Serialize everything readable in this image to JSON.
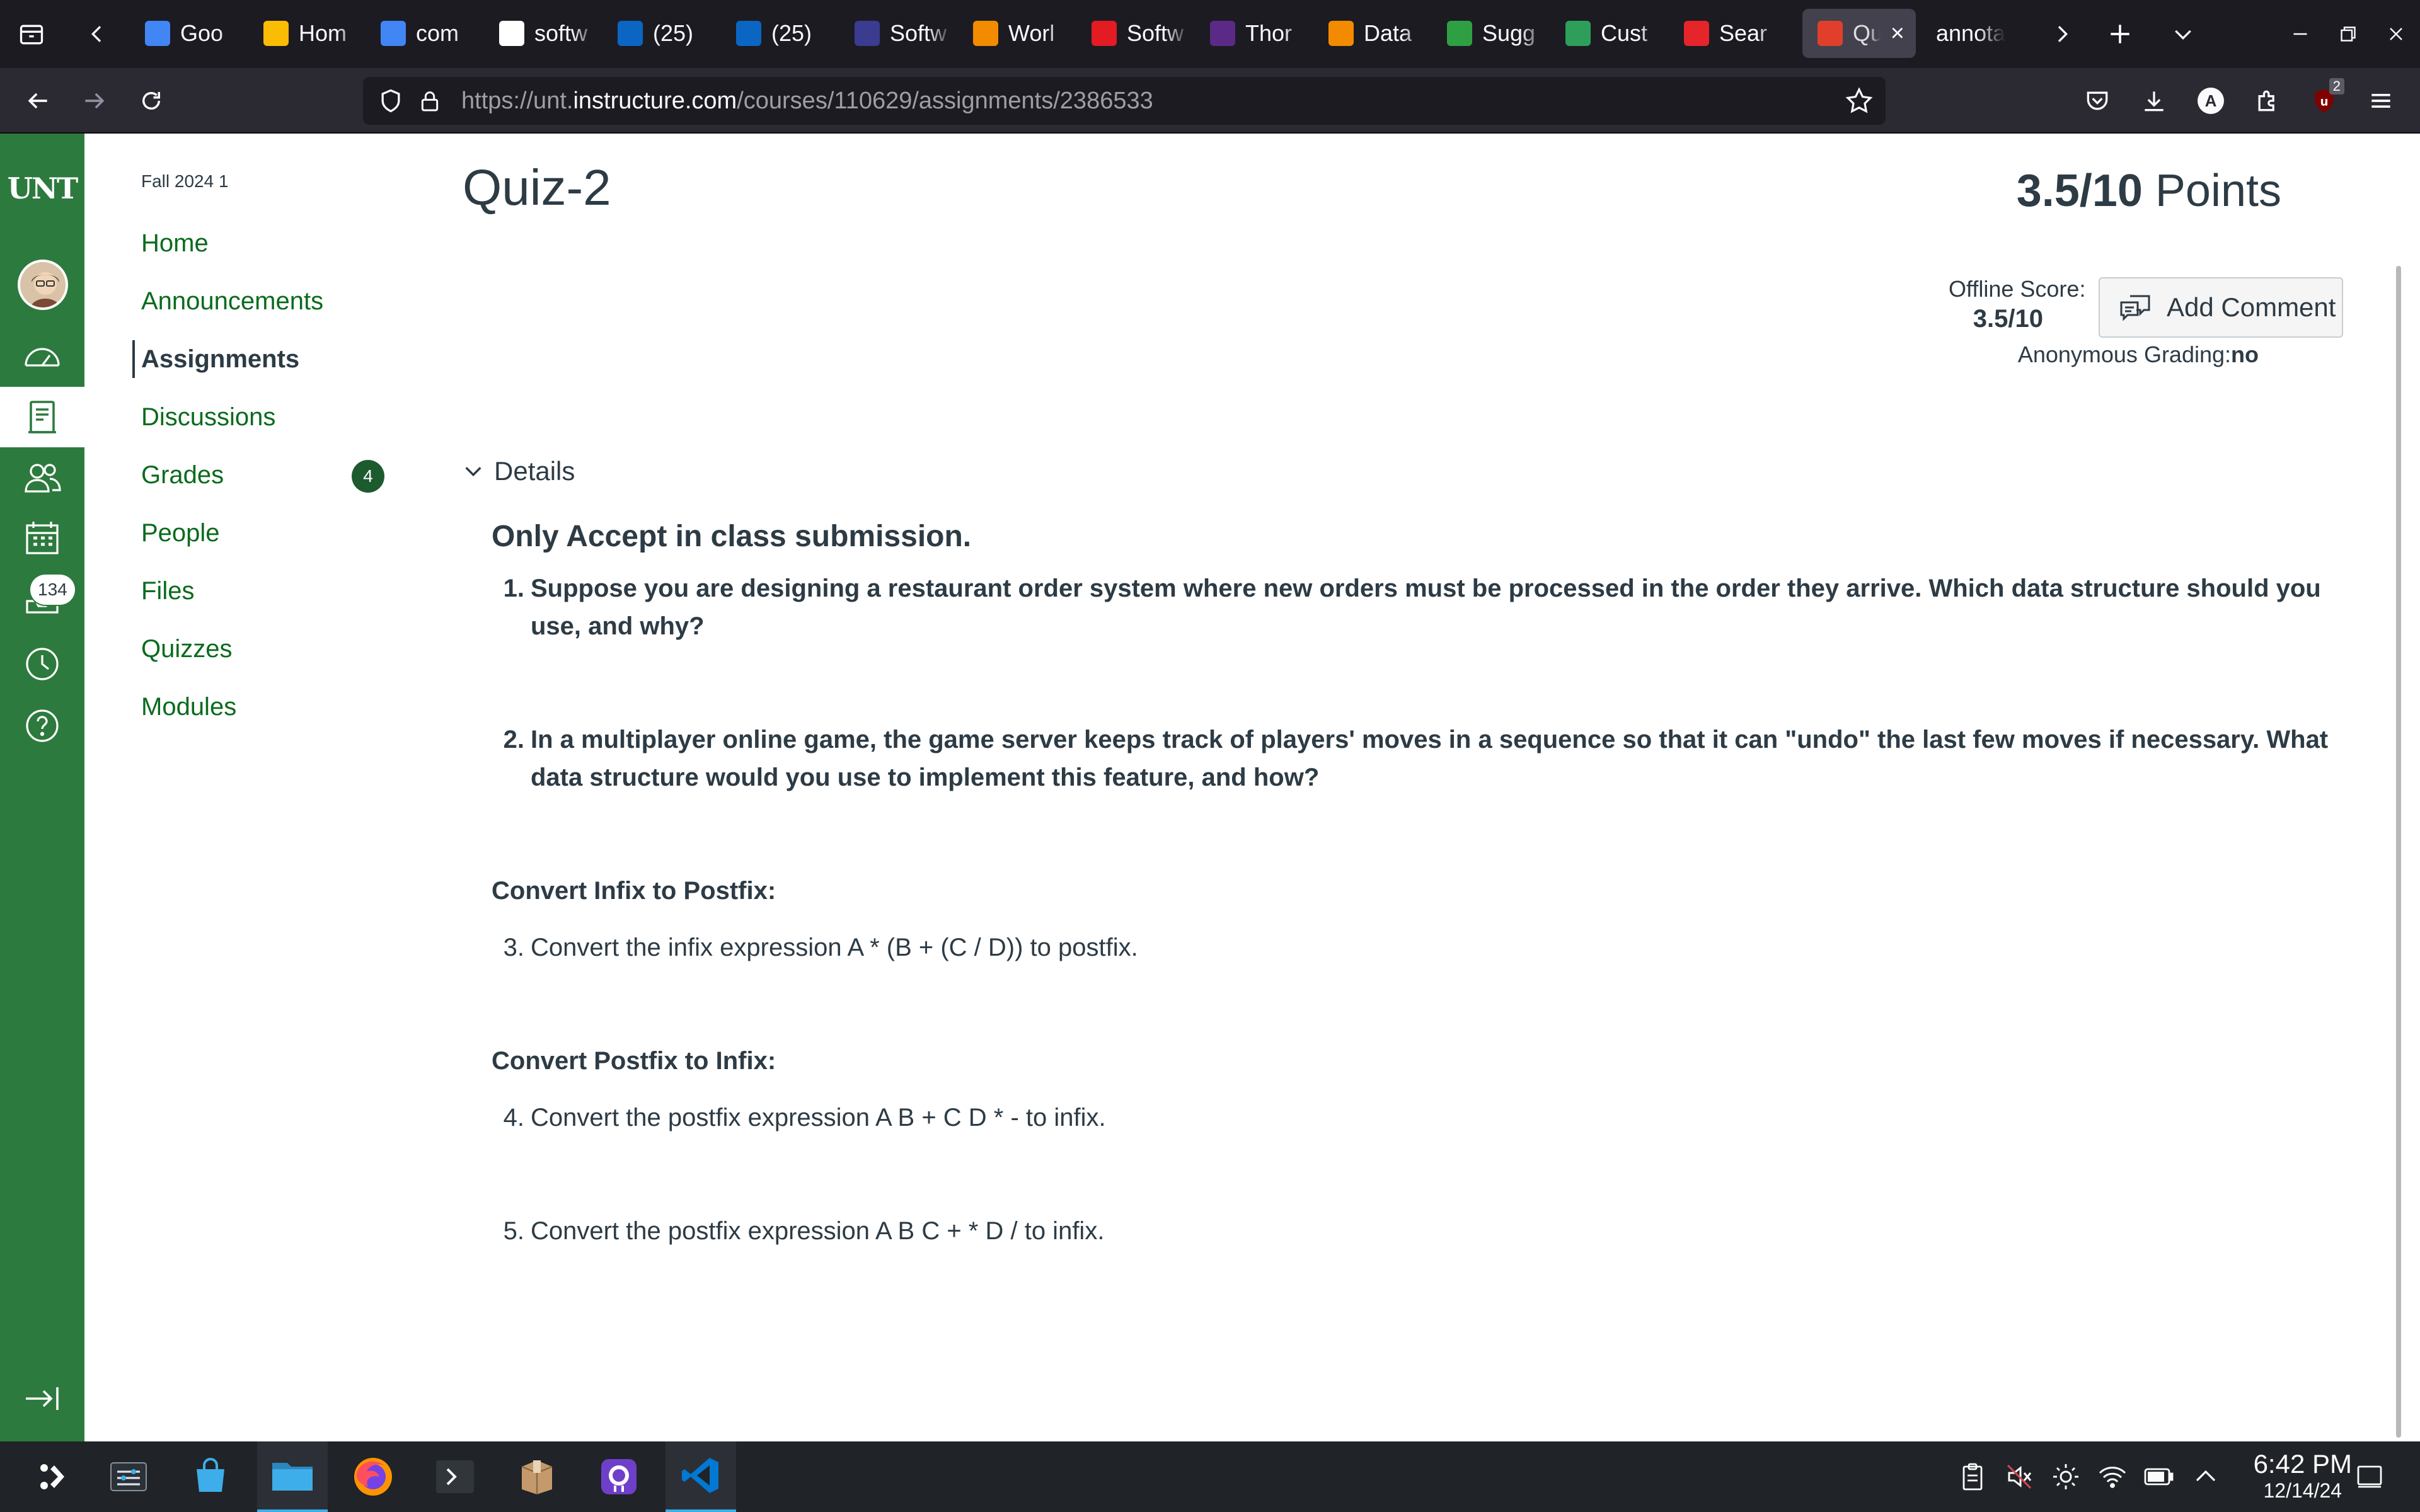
{
  "browser": {
    "tabs": [
      {
        "label": "Goo",
        "icon": "google-docs-icon",
        "color": "#4285f4"
      },
      {
        "label": "Hom",
        "icon": "google-drive-icon",
        "color": "#fbbc04"
      },
      {
        "label": "com",
        "icon": "google-docs-icon",
        "color": "#4285f4"
      },
      {
        "label": "softw",
        "icon": "google-icon",
        "color": "#ffffff"
      },
      {
        "label": "(25)",
        "icon": "linkedin-icon",
        "color": "#0a66c2"
      },
      {
        "label": "(25)",
        "icon": "linkedin-icon",
        "color": "#0a66c2"
      },
      {
        "label": "Softw",
        "icon": "globe-icon",
        "color": "#3b3b8f"
      },
      {
        "label": "Worl",
        "icon": "workday-icon",
        "color": "#f38b00"
      },
      {
        "label": "Softw",
        "icon": "dice-icon",
        "color": "#e31b23"
      },
      {
        "label": "Thor",
        "icon": "jobs-icon",
        "color": "#5b2a86"
      },
      {
        "label": "Data",
        "icon": "workday-icon",
        "color": "#f38b00"
      },
      {
        "label": "Sugg",
        "icon": "leaf-icon",
        "color": "#2ea043"
      },
      {
        "label": "Cust",
        "icon": "star-icon",
        "color": "#2e9e5b"
      },
      {
        "label": "Sear",
        "icon": "search-engine-icon",
        "color": "#e5252a"
      },
      {
        "label": "Qu",
        "icon": "canvas-icon",
        "color": "#e13f2b",
        "active": true
      },
      {
        "label": "annotat",
        "icon": "",
        "color": ""
      }
    ],
    "url": {
      "prefix": "https://unt.",
      "host": "instructure.com",
      "path": "/courses/110629/assignments/2386533"
    },
    "ublock_count": "2",
    "account_initial": "A"
  },
  "global_nav": {
    "logo": "UNT",
    "inbox_count": "134",
    "accent": "#2d7a3e"
  },
  "course_nav": {
    "term": "Fall 2024 1",
    "items": [
      "Home",
      "Announcements",
      "Assignments",
      "Discussions",
      "Grades",
      "People",
      "Files",
      "Quizzes",
      "Modules"
    ],
    "active": "Assignments",
    "grades_badge": "4"
  },
  "assignment": {
    "title": "Quiz-2",
    "points_score": "3.5/10",
    "points_label": "Points",
    "offline_label": "Offline Score:",
    "offline_value": "3.5/10",
    "add_comment": "Add Comment",
    "anon_label": "Anonymous Grading:",
    "anon_value": "no",
    "details_label": "Details",
    "heading": "Only Accept in class submission.",
    "q1": "Suppose you are designing a restaurant order system where new orders must be processed in the order they arrive. Which data structure should you use, and why?",
    "q2": "In a multiplayer online game, the game server keeps track of players' moves in a sequence so that it can \"undo\" the last few moves if necessary. What data structure would you use to implement this feature, and how?",
    "section_infix": "Convert Infix to Postfix:",
    "q3": "Convert the infix expression A * (B + (C / D)) to postfix.",
    "section_postfix": "Convert Postfix to Infix:",
    "q4": "Convert the postfix expression A B + C D * - to infix.",
    "q5": "Convert the postfix expression A B C + * D / to infix.",
    "numbers": [
      "1.",
      "2.",
      "3.",
      "4.",
      "5."
    ]
  },
  "taskbar": {
    "time": "6:42 PM",
    "date": "12/14/24"
  }
}
